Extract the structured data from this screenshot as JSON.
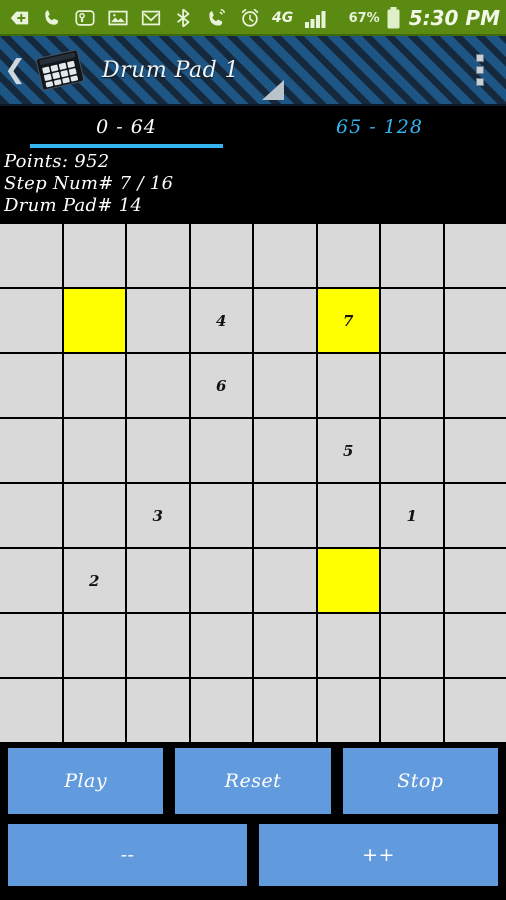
{
  "statusbar": {
    "icons": [
      "download-arrow-icon",
      "phone-icon",
      "voicemail-icon",
      "gallery-icon",
      "gmail-icon",
      "bluetooth-icon",
      "phone-missed-icon",
      "alarm-clock-icon"
    ],
    "network_label": "4G",
    "signal_icon": "signal-bars-icon",
    "battery_percent": "67%",
    "battery_icon": "battery-icon",
    "time": "5:30 PM",
    "background_color": "#5b8a13"
  },
  "titlebar": {
    "back_icon": "back-chevron-icon",
    "app_icon": "drum-pad-device-icon",
    "title": "Drum Pad 1",
    "drag_handle_icon": "resize-triangle-icon",
    "overflow_icon": "overflow-menu-icon",
    "stripe_dark": "#16293c",
    "stripe_light": "#1d5585"
  },
  "tabs": {
    "items": [
      {
        "label": "0 - 64",
        "active": true
      },
      {
        "label": "65 - 128",
        "active": false
      }
    ],
    "accent_color": "#35b4ee"
  },
  "info": {
    "points": "Points: 952",
    "step": "Step Num# 7 / 16",
    "pad": "Drum Pad# 14"
  },
  "grid": {
    "columns": 8,
    "rows": 8,
    "cell_color": "#d9d9d9",
    "highlight_color": "#ffff00",
    "cells": [
      [
        {
          "t": "",
          "h": false
        },
        {
          "t": "",
          "h": false
        },
        {
          "t": "",
          "h": false
        },
        {
          "t": "",
          "h": false
        },
        {
          "t": "",
          "h": false
        },
        {
          "t": "",
          "h": false
        },
        {
          "t": "",
          "h": false
        },
        {
          "t": "",
          "h": false
        }
      ],
      [
        {
          "t": "",
          "h": false
        },
        {
          "t": "",
          "h": true
        },
        {
          "t": "",
          "h": false
        },
        {
          "t": "4",
          "h": false
        },
        {
          "t": "",
          "h": false
        },
        {
          "t": "7",
          "h": true
        },
        {
          "t": "",
          "h": false
        },
        {
          "t": "",
          "h": false
        }
      ],
      [
        {
          "t": "",
          "h": false
        },
        {
          "t": "",
          "h": false
        },
        {
          "t": "",
          "h": false
        },
        {
          "t": "6",
          "h": false
        },
        {
          "t": "",
          "h": false
        },
        {
          "t": "",
          "h": false
        },
        {
          "t": "",
          "h": false
        },
        {
          "t": "",
          "h": false
        }
      ],
      [
        {
          "t": "",
          "h": false
        },
        {
          "t": "",
          "h": false
        },
        {
          "t": "",
          "h": false
        },
        {
          "t": "",
          "h": false
        },
        {
          "t": "",
          "h": false
        },
        {
          "t": "5",
          "h": false
        },
        {
          "t": "",
          "h": false
        },
        {
          "t": "",
          "h": false
        }
      ],
      [
        {
          "t": "",
          "h": false
        },
        {
          "t": "",
          "h": false
        },
        {
          "t": "3",
          "h": false
        },
        {
          "t": "",
          "h": false
        },
        {
          "t": "",
          "h": false
        },
        {
          "t": "",
          "h": false
        },
        {
          "t": "1",
          "h": false
        },
        {
          "t": "",
          "h": false
        }
      ],
      [
        {
          "t": "",
          "h": false
        },
        {
          "t": "2",
          "h": false
        },
        {
          "t": "",
          "h": false
        },
        {
          "t": "",
          "h": false
        },
        {
          "t": "",
          "h": false
        },
        {
          "t": "",
          "h": true
        },
        {
          "t": "",
          "h": false
        },
        {
          "t": "",
          "h": false
        }
      ],
      [
        {
          "t": "",
          "h": false
        },
        {
          "t": "",
          "h": false
        },
        {
          "t": "",
          "h": false
        },
        {
          "t": "",
          "h": false
        },
        {
          "t": "",
          "h": false
        },
        {
          "t": "",
          "h": false
        },
        {
          "t": "",
          "h": false
        },
        {
          "t": "",
          "h": false
        }
      ],
      [
        {
          "t": "",
          "h": false
        },
        {
          "t": "",
          "h": false
        },
        {
          "t": "",
          "h": false
        },
        {
          "t": "",
          "h": false
        },
        {
          "t": "",
          "h": false
        },
        {
          "t": "",
          "h": false
        },
        {
          "t": "",
          "h": false
        },
        {
          "t": "",
          "h": false
        }
      ]
    ]
  },
  "controls": {
    "play": "Play",
    "reset": "Reset",
    "stop": "Stop",
    "decrement": "--",
    "increment": "++",
    "button_color": "#629bdd"
  }
}
